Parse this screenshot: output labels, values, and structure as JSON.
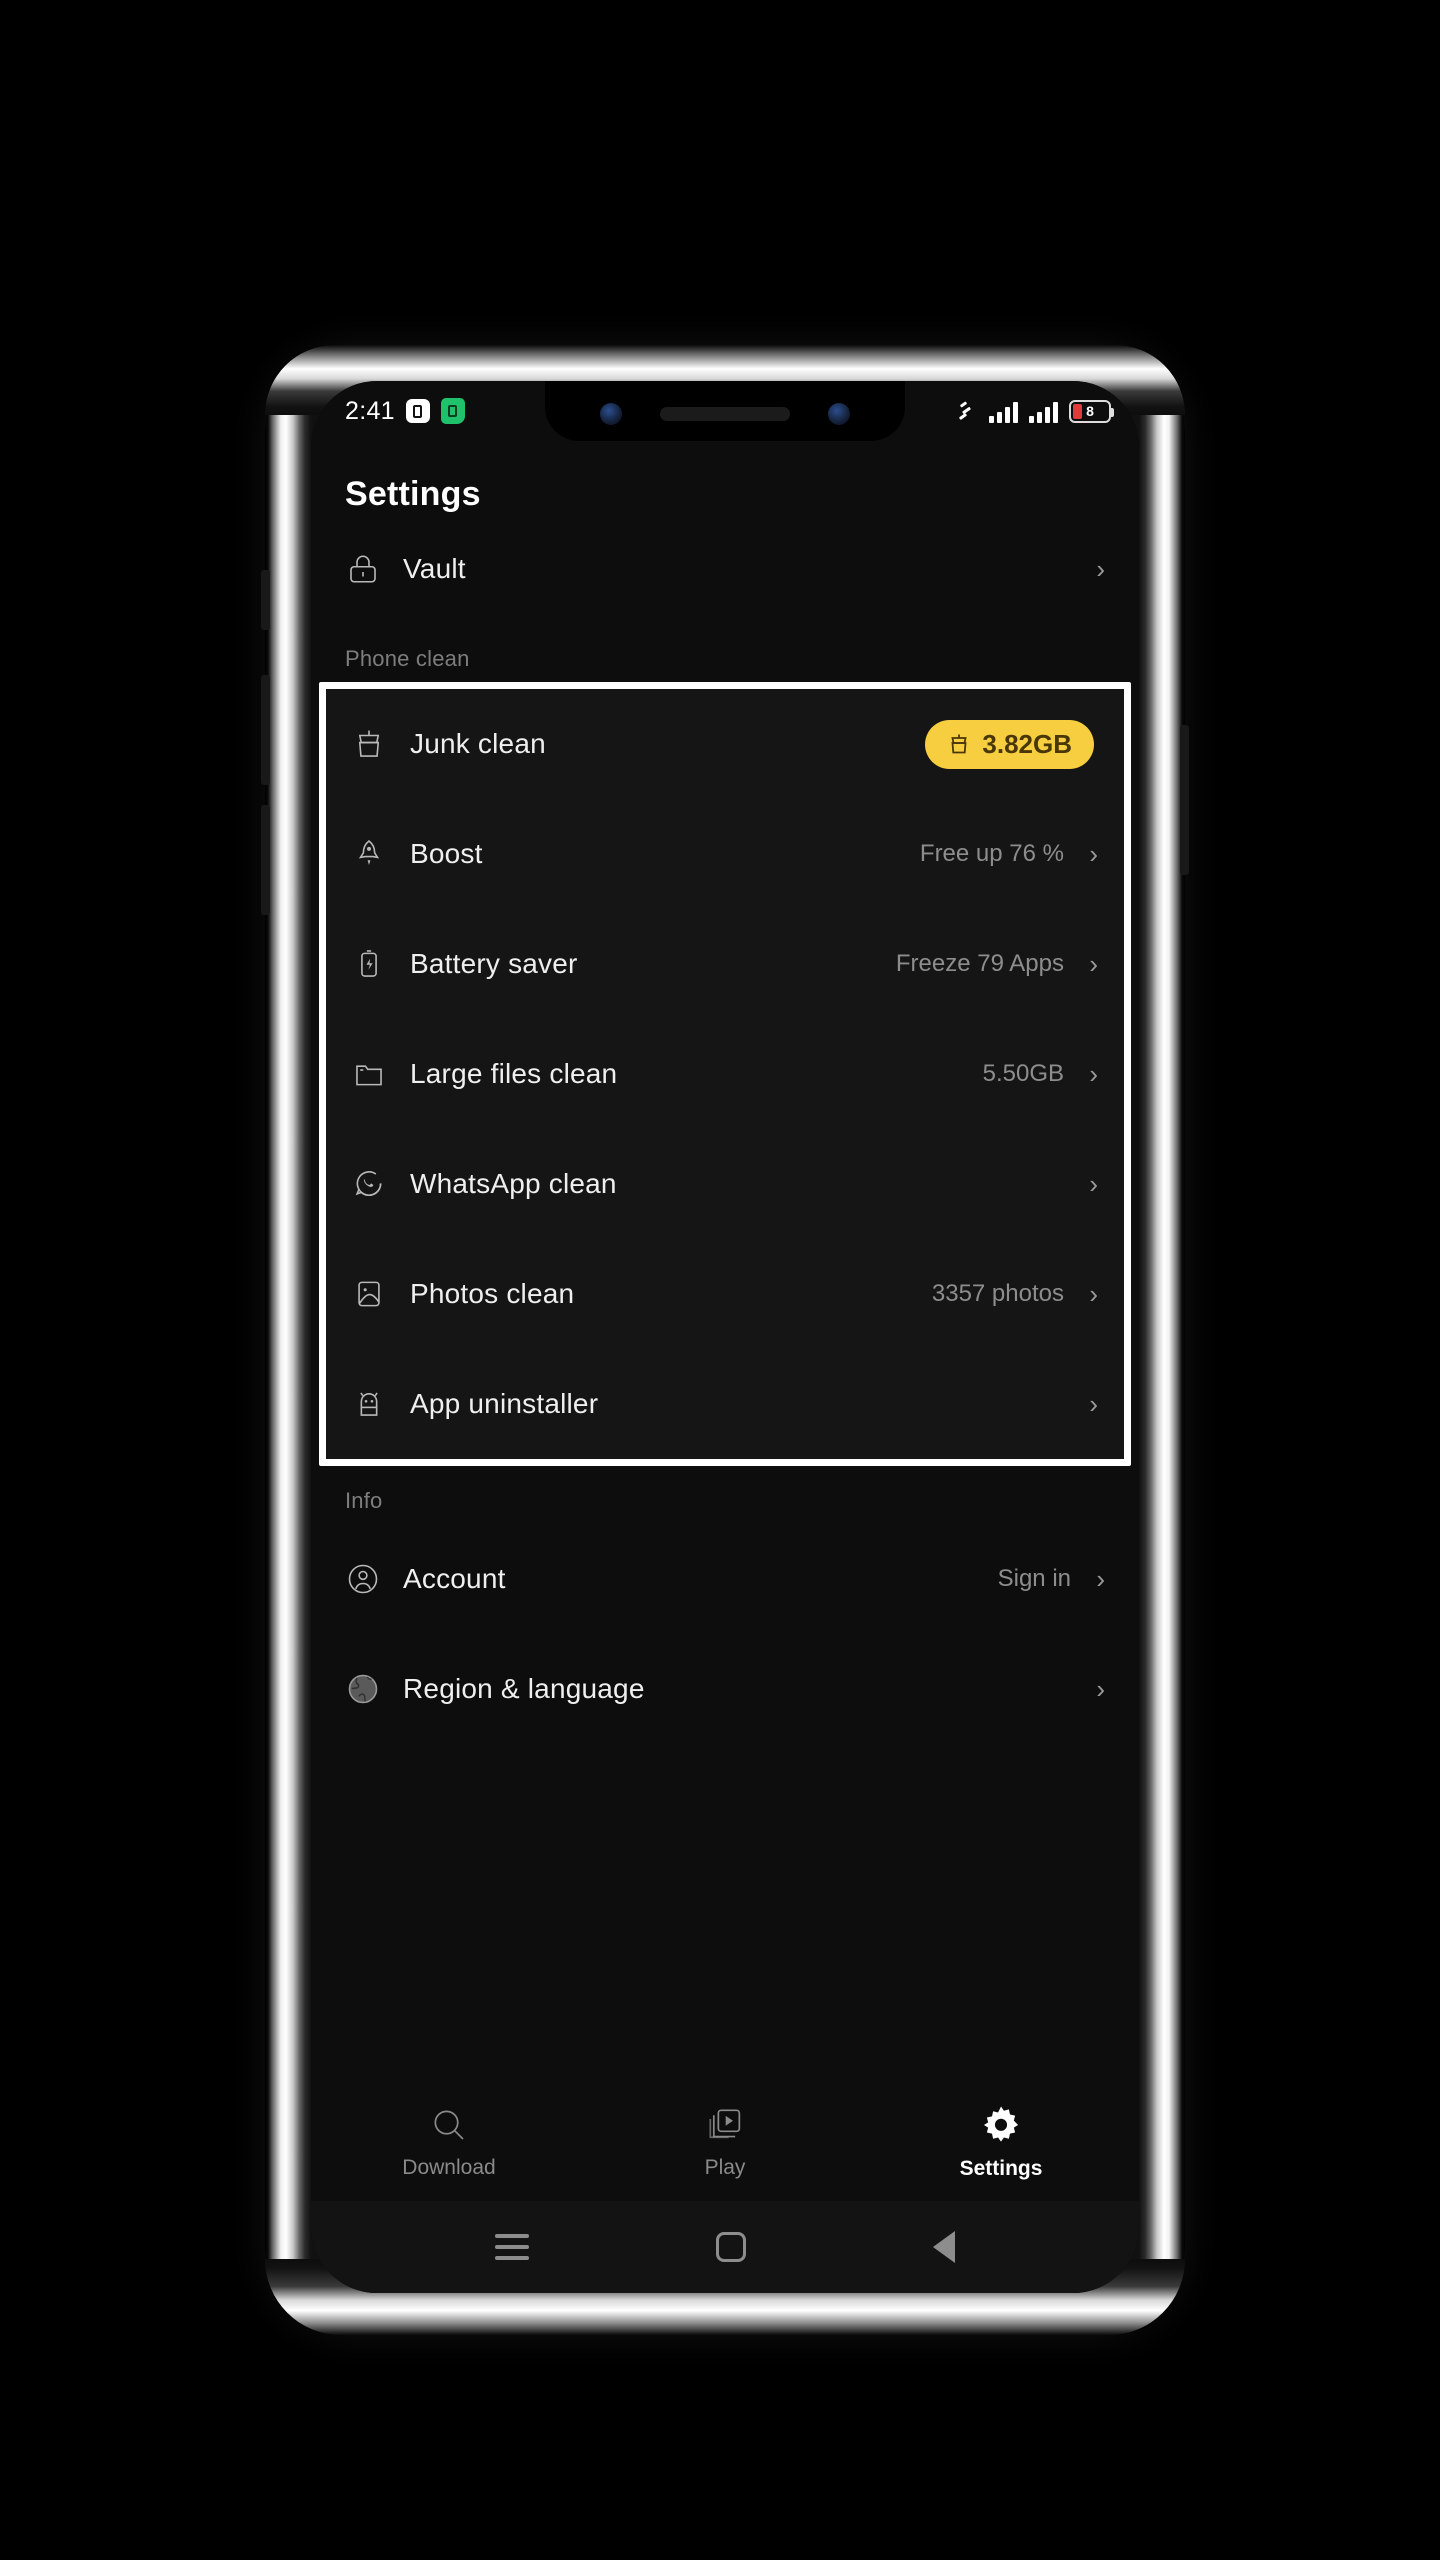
{
  "statusbar": {
    "time": "2:41",
    "battery_level": "8",
    "icons": [
      "app-badge-icon",
      "green-app-icon",
      "vibrate-icon",
      "signal-bars-icon",
      "signal-bars-icon",
      "battery-icon"
    ]
  },
  "header": {
    "title": "Settings"
  },
  "top_items": [
    {
      "label": "Vault",
      "value": "",
      "icon": "lock-icon",
      "chevron": "›"
    }
  ],
  "sections": [
    {
      "label": "Phone clean"
    },
    {
      "label": "Info"
    }
  ],
  "phone_clean": {
    "highlighted": true,
    "items": [
      {
        "label": "Junk clean",
        "value": "3.82GB",
        "icon": "trash-icon",
        "badge": true,
        "badge_color": "#F7CE3F",
        "badge_text_color": "#4a3708",
        "chevron": ""
      },
      {
        "label": "Boost",
        "value": "Free up 76 %",
        "icon": "rocket-icon",
        "badge": false,
        "chevron": "›"
      },
      {
        "label": "Battery saver",
        "value": "Freeze 79 Apps",
        "icon": "battery-bolt-icon",
        "badge": false,
        "chevron": "›"
      },
      {
        "label": "Large files clean",
        "value": "5.50GB",
        "icon": "folder-icon",
        "badge": false,
        "chevron": "›"
      },
      {
        "label": "WhatsApp clean",
        "value": "",
        "icon": "whatsapp-icon",
        "badge": false,
        "chevron": "›"
      },
      {
        "label": "Photos clean",
        "value": "3357 photos",
        "icon": "photo-icon",
        "badge": false,
        "chevron": "›"
      },
      {
        "label": "App uninstaller",
        "value": "",
        "icon": "android-icon",
        "badge": false,
        "chevron": "›"
      }
    ]
  },
  "info": {
    "items": [
      {
        "label": "Account",
        "value": "Sign in",
        "icon": "account-icon",
        "chevron": "›"
      },
      {
        "label": "Region & language",
        "value": "",
        "icon": "globe-icon",
        "chevron": "›"
      }
    ]
  },
  "tabbar": {
    "tabs": [
      {
        "label": "Download",
        "icon": "search-icon",
        "active": false
      },
      {
        "label": "Play",
        "icon": "video-library-icon",
        "active": false
      },
      {
        "label": "Settings",
        "icon": "gear-icon",
        "active": true
      }
    ]
  },
  "navbar": {
    "buttons": [
      {
        "name": "recents",
        "icon": "menu-icon"
      },
      {
        "name": "home",
        "icon": "home-square-icon"
      },
      {
        "name": "back",
        "icon": "back-triangle-icon"
      }
    ]
  },
  "colors": {
    "accent": "#F7CE3F",
    "highlight_border": "#FFFFFF",
    "screen_bg": "#0d0d0d",
    "card_bg": "#151515",
    "text_primary": "#EFEFEF",
    "text_secondary": "#8D8D8D",
    "battery_low": "#E23B3B"
  }
}
